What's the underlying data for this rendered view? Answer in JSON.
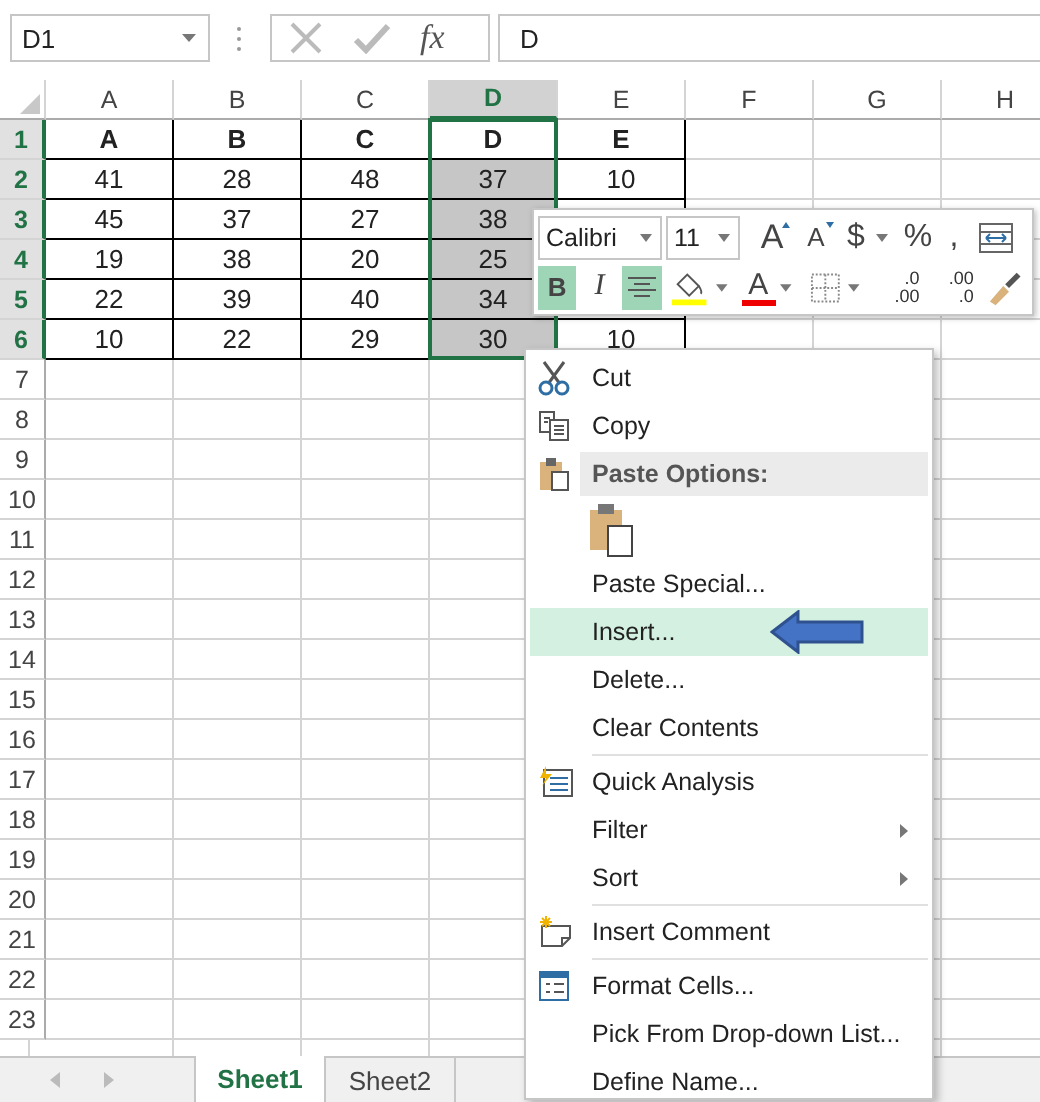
{
  "formula_bar": {
    "name_box": "D1",
    "fx": "fx",
    "value": "D"
  },
  "columns": [
    {
      "label": "A",
      "selected": false
    },
    {
      "label": "B",
      "selected": false
    },
    {
      "label": "C",
      "selected": false
    },
    {
      "label": "D",
      "selected": true
    },
    {
      "label": "E",
      "selected": false
    },
    {
      "label": "F",
      "selected": false
    },
    {
      "label": "G",
      "selected": false
    },
    {
      "label": "H",
      "selected": false
    }
  ],
  "rows": [
    {
      "header": "1",
      "selected": true,
      "cells": [
        {
          "text": "A",
          "selected": false
        },
        {
          "text": "B",
          "selected": false
        },
        {
          "text": "C",
          "selected": false
        },
        {
          "text": "D",
          "selected": false
        },
        {
          "text": "E",
          "selected": false
        }
      ]
    },
    {
      "header": "2",
      "selected": true,
      "cells": [
        {
          "text": "41",
          "selected": false
        },
        {
          "text": "28",
          "selected": false
        },
        {
          "text": "48",
          "selected": false
        },
        {
          "text": "37",
          "selected": true
        },
        {
          "text": "10",
          "selected": false
        }
      ]
    },
    {
      "header": "3",
      "selected": true,
      "cells": [
        {
          "text": "45",
          "selected": false
        },
        {
          "text": "37",
          "selected": false
        },
        {
          "text": "27",
          "selected": false
        },
        {
          "text": "38",
          "selected": true
        }
      ]
    },
    {
      "header": "4",
      "selected": true,
      "cells": [
        {
          "text": "19",
          "selected": false
        },
        {
          "text": "38",
          "selected": false
        },
        {
          "text": "20",
          "selected": false
        },
        {
          "text": "25",
          "selected": true
        }
      ]
    },
    {
      "header": "5",
      "selected": true,
      "cells": [
        {
          "text": "22",
          "selected": false
        },
        {
          "text": "39",
          "selected": false
        },
        {
          "text": "40",
          "selected": false
        },
        {
          "text": "34",
          "selected": true
        }
      ]
    },
    {
      "header": "6",
      "selected": true,
      "cells": [
        {
          "text": "10",
          "selected": false
        },
        {
          "text": "22",
          "selected": false
        },
        {
          "text": "29",
          "selected": false
        },
        {
          "text": "30",
          "selected": true
        },
        {
          "text": "10",
          "selected": false
        }
      ]
    },
    {
      "header": "7",
      "selected": false,
      "cells": []
    },
    {
      "header": "8",
      "selected": false,
      "cells": []
    },
    {
      "header": "9",
      "selected": false,
      "cells": []
    },
    {
      "header": "10",
      "selected": false,
      "cells": []
    },
    {
      "header": "11",
      "selected": false,
      "cells": []
    },
    {
      "header": "12",
      "selected": false,
      "cells": []
    },
    {
      "header": "13",
      "selected": false,
      "cells": []
    },
    {
      "header": "14",
      "selected": false,
      "cells": []
    },
    {
      "header": "15",
      "selected": false,
      "cells": []
    },
    {
      "header": "16",
      "selected": false,
      "cells": []
    },
    {
      "header": "17",
      "selected": false,
      "cells": []
    },
    {
      "header": "18",
      "selected": false,
      "cells": []
    },
    {
      "header": "19",
      "selected": false,
      "cells": []
    },
    {
      "header": "20",
      "selected": false,
      "cells": []
    },
    {
      "header": "21",
      "selected": false,
      "cells": []
    },
    {
      "header": "22",
      "selected": false,
      "cells": []
    },
    {
      "header": "23",
      "selected": false,
      "cells": []
    }
  ],
  "sheets": [
    {
      "label": "Sheet1",
      "selected": true
    },
    {
      "label": "Sheet2",
      "selected": false
    }
  ],
  "mini_toolbar": {
    "font": "Calibri",
    "size": "11",
    "row1": [
      {
        "kind": "grow",
        "text": "A",
        "dropdown": false
      },
      {
        "kind": "shrink",
        "text": "A",
        "dropdown": false
      },
      {
        "kind": "symbol",
        "text": "$",
        "dropdown": true
      },
      {
        "kind": "symbol",
        "text": "%",
        "dropdown": false
      },
      {
        "kind": "symbol",
        "text": ",",
        "dropdown": false
      },
      {
        "kind": "wrap",
        "dropdown": false
      }
    ],
    "row2": [
      {
        "kind": "bold",
        "text": "B",
        "on": true,
        "dropdown": false
      },
      {
        "kind": "italic",
        "text": "I",
        "on": false,
        "dropdown": false
      },
      {
        "kind": "align",
        "on": true,
        "dropdown": false
      },
      {
        "kind": "fill",
        "on": false,
        "dropdown": true
      },
      {
        "kind": "font-color",
        "text": "A",
        "on": false,
        "dropdown": true
      },
      {
        "kind": "borders",
        "on": false,
        "dropdown": true
      },
      {
        "kind": "inc-decimal",
        "top": ".0",
        "bottom": ".00",
        "on": false,
        "dropdown": false
      },
      {
        "kind": "dec-decimal",
        "top": ".00",
        "bottom": ".0",
        "on": false,
        "dropdown": false
      },
      {
        "kind": "painter",
        "on": false,
        "dropdown": false
      }
    ]
  },
  "context_menu": [
    {
      "kind": "command",
      "label": "Cut",
      "selected": false,
      "submenu": false
    },
    {
      "kind": "command",
      "label": "Copy",
      "selected": false,
      "submenu": false
    },
    {
      "kind": "header",
      "label": "Paste Options:"
    },
    {
      "kind": "paste-icons"
    },
    {
      "kind": "command",
      "label": "Paste Special...",
      "selected": false,
      "submenu": false
    },
    {
      "kind": "command",
      "label": "Insert...",
      "selected": true,
      "submenu": false,
      "pointer": true
    },
    {
      "kind": "command",
      "label": "Delete...",
      "selected": false,
      "submenu": false
    },
    {
      "kind": "command",
      "label": "Clear Contents",
      "selected": false,
      "submenu": false
    },
    {
      "kind": "separator"
    },
    {
      "kind": "command",
      "label": "Quick Analysis",
      "selected": false,
      "submenu": false
    },
    {
      "kind": "command",
      "label": "Filter",
      "selected": false,
      "submenu": true
    },
    {
      "kind": "command",
      "label": "Sort",
      "selected": false,
      "submenu": true
    },
    {
      "kind": "separator"
    },
    {
      "kind": "command",
      "label": "Insert Comment",
      "selected": false,
      "submenu": false
    },
    {
      "kind": "separator"
    },
    {
      "kind": "command",
      "label": "Format Cells...",
      "selected": false,
      "submenu": false
    },
    {
      "kind": "command",
      "label": "Pick From Drop-down List...",
      "selected": false,
      "submenu": false
    },
    {
      "kind": "command",
      "label": "Define Name...",
      "selected": false,
      "submenu": false
    }
  ]
}
